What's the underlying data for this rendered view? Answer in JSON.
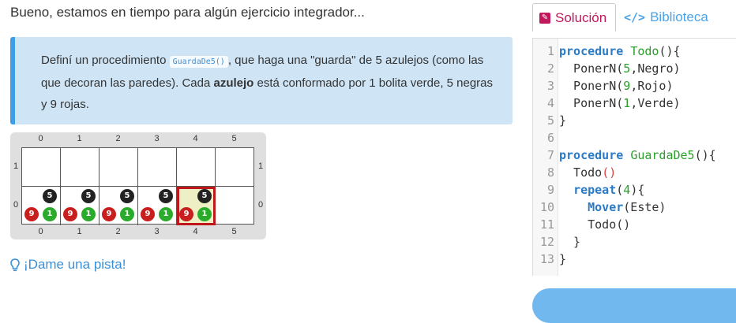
{
  "intro": "Bueno, estamos en tiempo para algún ejercicio integrador...",
  "instructions": {
    "p1": "Definí un procedimiento ",
    "code": "GuardaDe5()",
    "p2": ", que haga una \"guarda\" de 5 azulejos (como las que decoran las paredes). Cada ",
    "bold": "azulejo",
    "p3": " está conformado por 1 bolita verde, 5 negras y 9 rojas."
  },
  "board": {
    "columns": [
      "0",
      "1",
      "2",
      "3",
      "4",
      "5"
    ],
    "rows": [
      "1",
      "0"
    ],
    "tiles": [
      {
        "col": 0,
        "row": 0,
        "black": "5",
        "red": "9",
        "green": "1"
      },
      {
        "col": 1,
        "row": 0,
        "black": "5",
        "red": "9",
        "green": "1"
      },
      {
        "col": 2,
        "row": 0,
        "black": "5",
        "red": "9",
        "green": "1"
      },
      {
        "col": 3,
        "row": 0,
        "black": "5",
        "red": "9",
        "green": "1"
      },
      {
        "col": 4,
        "row": 0,
        "black": "5",
        "red": "9",
        "green": "1",
        "head": true
      }
    ]
  },
  "hint": "¡Dame una pista!",
  "tabs": {
    "solution": "Solución",
    "library": "Biblioteca"
  },
  "colors": {
    "accent": "#3d9ee6",
    "callout_bg": "#cfe5f6",
    "tab_active": "#c2185b",
    "head_border": "#c0171c"
  },
  "code_lines": [
    {
      "n": "1",
      "html": "<span class='kw'>procedure</span> <span class='fn'>Todo</span>(){"
    },
    {
      "n": "2",
      "html": "  PonerN(<span class='num'>5</span>,Negro)"
    },
    {
      "n": "3",
      "html": "  PonerN(<span class='num'>9</span>,Rojo)"
    },
    {
      "n": "4",
      "html": "  PonerN(<span class='num'>1</span>,Verde)"
    },
    {
      "n": "5",
      "html": "}"
    },
    {
      "n": "6",
      "html": ""
    },
    {
      "n": "7",
      "html": "<span class='kw'>procedure</span> <span class='fn'>GuardaDe5</span>(){"
    },
    {
      "n": "8",
      "html": "  Todo<span class='par'>()</span>"
    },
    {
      "n": "9",
      "html": "  <span class='kw'>repeat</span>(<span class='num'>4</span>){"
    },
    {
      "n": "10",
      "html": "    <span class='kw'>Mover</span>(Este)"
    },
    {
      "n": "11",
      "html": "    Todo()"
    },
    {
      "n": "12",
      "html": "  }"
    },
    {
      "n": "13",
      "html": "}"
    }
  ]
}
